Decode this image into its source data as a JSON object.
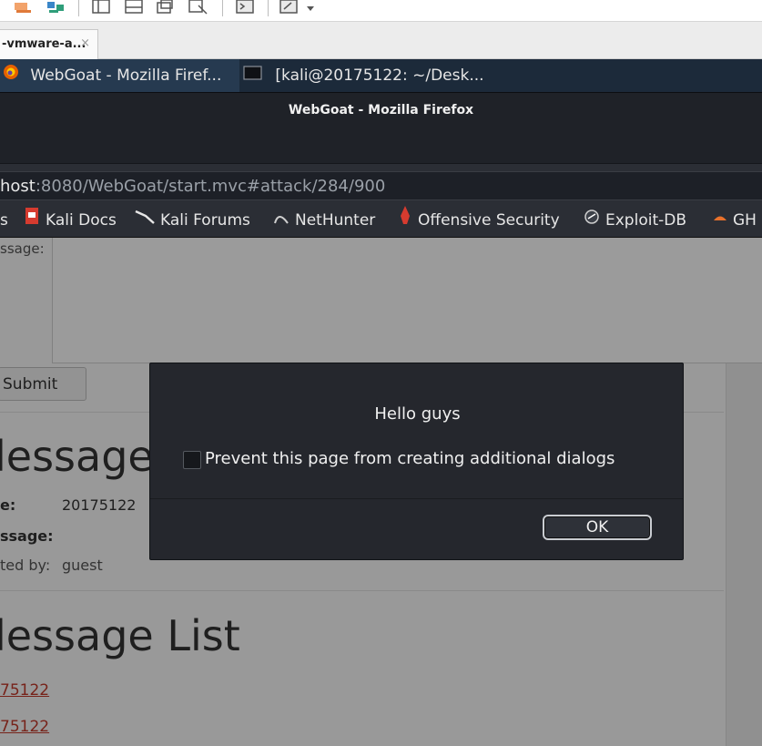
{
  "vmware": {
    "tab_label": "-vmware-a...",
    "tab_close": "×"
  },
  "taskbar": {
    "items": [
      {
        "label": "WebGoat - Mozilla Firef..."
      },
      {
        "label": "[kali@20175122: ~/Desk..."
      }
    ]
  },
  "firefox": {
    "window_title": "WebGoat - Mozilla Firefox",
    "url_host": "host",
    "url_rest": ":8080/WebGoat/start.mvc#attack/284/900",
    "bookmarks": [
      {
        "label": "s"
      },
      {
        "label": "Kali Docs"
      },
      {
        "label": "Kali Forums"
      },
      {
        "label": "NetHunter"
      },
      {
        "label": "Offensive Security"
      },
      {
        "label": "Exploit-DB"
      },
      {
        "label": "GH"
      }
    ]
  },
  "page": {
    "message_label": "ssage:",
    "submit_label": "Submit",
    "message_heading": "lessage",
    "title_label": "e:",
    "title_value": "20175122",
    "message_row_label": "ssage:",
    "posted_by_label": "ted by:",
    "posted_by_value": "guest",
    "list_heading": "lessage List",
    "list_links": [
      "75122",
      "75122"
    ]
  },
  "dialog": {
    "message": "Hello guys",
    "checkbox_label": "Prevent this page from creating additional dialogs",
    "checkbox_checked": false,
    "ok_label": "OK"
  }
}
